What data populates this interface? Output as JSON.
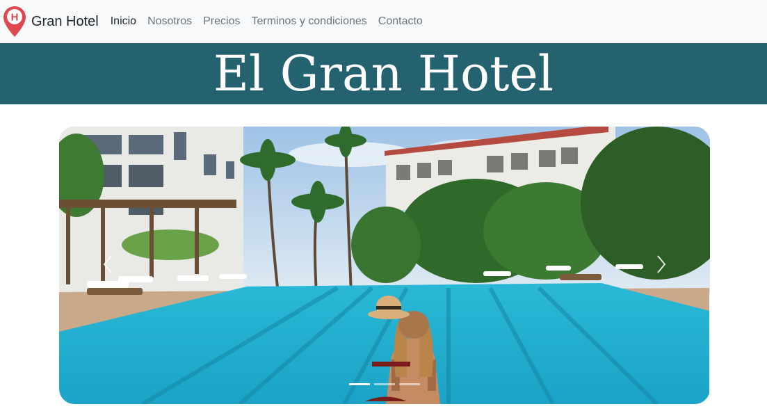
{
  "navbar": {
    "brand": "Gran Hotel",
    "brand_logo_icon": "hotel-location-pin-icon",
    "links": [
      {
        "label": "Inicio",
        "active": true
      },
      {
        "label": "Nosotros",
        "active": false
      },
      {
        "label": "Precios",
        "active": false
      },
      {
        "label": "Terminos y condiciones",
        "active": false
      },
      {
        "label": "Contacto",
        "active": false
      }
    ]
  },
  "hero": {
    "title": "El Gran Hotel",
    "background": "#246270"
  },
  "carousel": {
    "slide_image": "hotel-pool-photo",
    "prev_icon": "chevron-left-icon",
    "next_icon": "chevron-right-icon",
    "slides_count": 3,
    "active_slide": 1
  },
  "colors": {
    "accent_red": "#e0484f",
    "hero_teal": "#246270",
    "navbar_bg": "#f8f9fa"
  }
}
